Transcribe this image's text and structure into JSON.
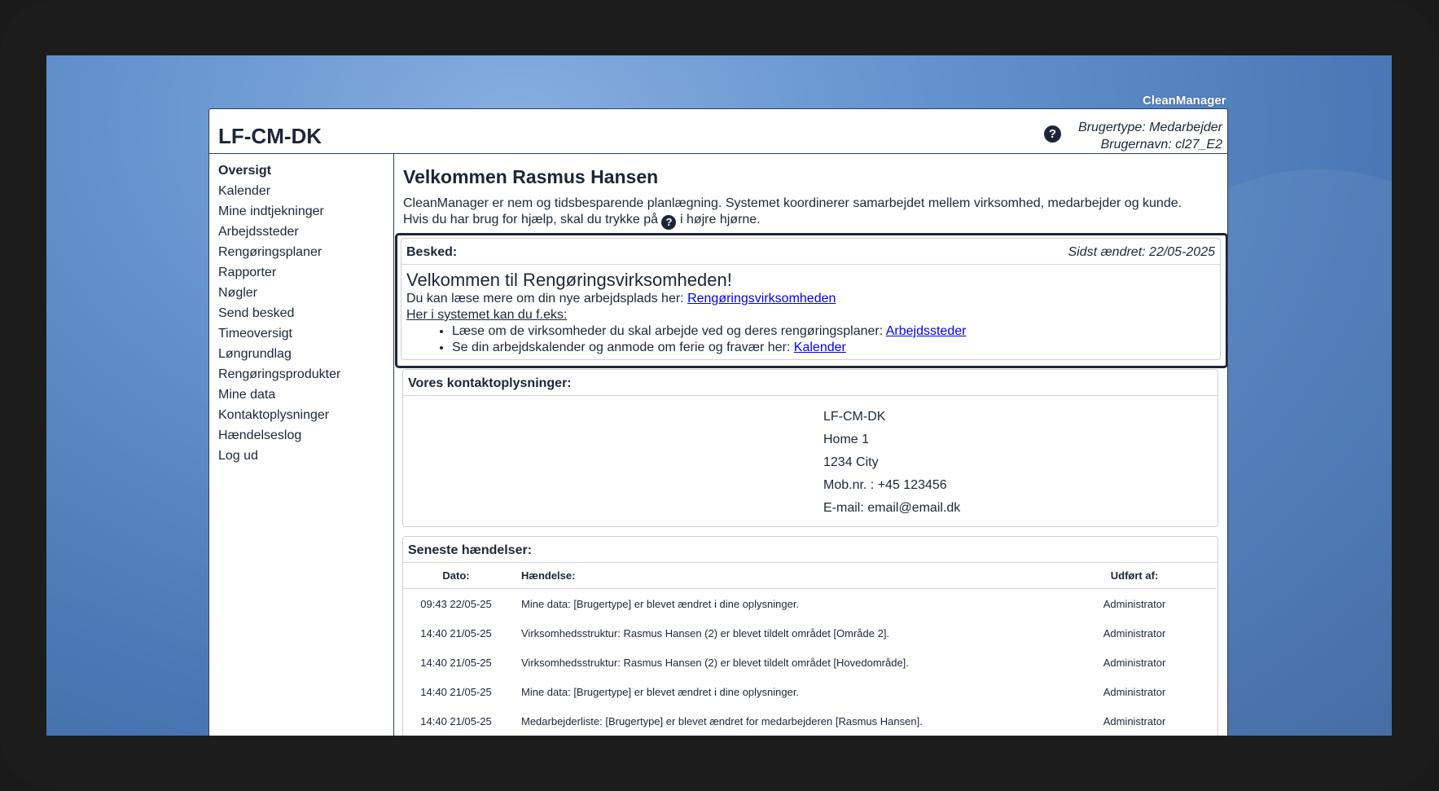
{
  "brand": "CleanManager",
  "header": {
    "org_title": "LF-CM-DK",
    "help_icon": "?",
    "user_type": "Brugertype: Medarbejder",
    "username": "Brugernavn: cl27_E2"
  },
  "sidebar": {
    "items": [
      {
        "label": "Oversigt"
      },
      {
        "label": "Kalender"
      },
      {
        "label": "Mine indtjekninger"
      },
      {
        "label": "Arbejdssteder"
      },
      {
        "label": "Rengøringsplaner"
      },
      {
        "label": "Rapporter"
      },
      {
        "label": "Nøgler"
      },
      {
        "label": "Send besked"
      },
      {
        "label": "Timeoversigt"
      },
      {
        "label": "Løngrundlag"
      },
      {
        "label": "Rengøringsprodukter"
      },
      {
        "label": "Mine data"
      },
      {
        "label": "Kontaktoplysninger"
      },
      {
        "label": "Hændelseslog"
      },
      {
        "label": "Log ud"
      }
    ]
  },
  "main": {
    "welcome_title": "Velkommen Rasmus Hansen",
    "intro_line1": "CleanManager er nem og tidsbesparende planlægning. Systemet koordinerer samarbejdet mellem virksomhed, medarbejder og kunde.",
    "intro_line2_pre": "Hvis du har brug for hjælp, skal du trykke på",
    "intro_line2_post": "i højre hjørne."
  },
  "message": {
    "label": "Besked:",
    "last_changed": "Sidst ændret: 22/05-2025",
    "heading": "Velkommen til Rengøringsvirksomheden!",
    "read_more_text": "Du kan læse mere om din nye arbejdsplads her:",
    "read_more_link": "Rengøringsvirksomheden",
    "system_intro": "Her i systemet kan du f.eks:",
    "bullet1_text": "Læse om de virksomheder du skal arbejde ved og deres rengøringsplaner:",
    "bullet1_link": "Arbejdssteder",
    "bullet2_text": "Se din arbejdskalender og anmode om ferie og fravær her:",
    "bullet2_link": "Kalender"
  },
  "contact": {
    "label": "Vores kontaktoplysninger:",
    "lines": [
      "LF-CM-DK",
      "Home 1",
      "1234 City",
      "Mob.nr. : +45 123456",
      "E-mail: email@email.dk"
    ]
  },
  "events": {
    "label": "Seneste hændelser:",
    "columns": {
      "date": "Dato:",
      "event": "Hændelse:",
      "by": "Udført af:"
    },
    "rows": [
      {
        "date": "09:43 22/05-25",
        "event": "Mine data: [Brugertype] er blevet ændret i dine oplysninger.",
        "by": "Administrator"
      },
      {
        "date": "14:40 21/05-25",
        "event": "Virksomhedsstruktur: Rasmus Hansen (2) er blevet tildelt området [Område 2].",
        "by": "Administrator"
      },
      {
        "date": "14:40 21/05-25",
        "event": "Virksomhedsstruktur: Rasmus Hansen (2) er blevet tildelt området [Hovedområde].",
        "by": "Administrator"
      },
      {
        "date": "14:40 21/05-25",
        "event": "Mine data: [Brugertype] er blevet ændret i dine oplysninger.",
        "by": "Administrator"
      },
      {
        "date": "14:40 21/05-25",
        "event": "Medarbejderliste: [Brugertype] er blevet ændret for medarbejderen [Rasmus Hansen].",
        "by": "Administrator"
      }
    ]
  }
}
